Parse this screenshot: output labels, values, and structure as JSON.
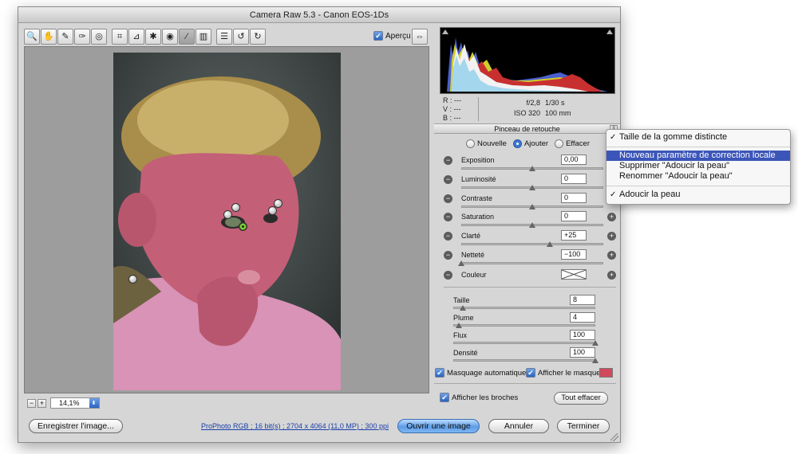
{
  "window": {
    "title": "Camera Raw 5.3  -  Canon EOS-1Ds"
  },
  "toolbar": {
    "tools": [
      {
        "name": "zoom-tool-icon",
        "glyph": "🔍"
      },
      {
        "name": "hand-tool-icon",
        "glyph": "✋"
      },
      {
        "name": "white-balance-tool-icon",
        "glyph": "✎"
      },
      {
        "name": "color-sampler-tool-icon",
        "glyph": "✑"
      },
      {
        "name": "targeted-adjustment-tool-icon",
        "glyph": "◎"
      },
      {
        "name": "crop-tool-icon",
        "glyph": "⌗"
      },
      {
        "name": "straighten-tool-icon",
        "glyph": "⊿"
      },
      {
        "name": "spot-removal-tool-icon",
        "glyph": "✱"
      },
      {
        "name": "red-eye-tool-icon",
        "glyph": "◉"
      },
      {
        "name": "adjustment-brush-icon",
        "glyph": "⁄"
      },
      {
        "name": "graduated-filter-icon",
        "glyph": "▥"
      },
      {
        "name": "preferences-icon",
        "glyph": "☰"
      },
      {
        "name": "rotate-left-icon",
        "glyph": "↺"
      },
      {
        "name": "rotate-right-icon",
        "glyph": "↻"
      }
    ],
    "preview_label": "Aperçu",
    "fullscreen_glyph": "⇔"
  },
  "zoom": {
    "value": "14,1%",
    "minus": "−",
    "plus": "+",
    "arrow": "⬍"
  },
  "readout": {
    "rgb": [
      "R :  ---",
      "V :  ---",
      "B :  ---"
    ],
    "aperture": "f/2,8",
    "shutter": "1/30 s",
    "iso": "ISO 320",
    "focal": "100 mm"
  },
  "panel": {
    "title": "Pinceau de retouche",
    "menu_glyph": "≡",
    "modes": [
      "Nouvelle",
      "Ajouter",
      "Effacer"
    ],
    "selected_mode": "Ajouter",
    "sliders": [
      {
        "label": "Exposition",
        "value": "0,00",
        "pos": 0.5
      },
      {
        "label": "Luminosité",
        "value": "0",
        "pos": 0.5
      },
      {
        "label": "Contraste",
        "value": "0",
        "pos": 0.5
      },
      {
        "label": "Saturation",
        "value": "0",
        "pos": 0.5
      },
      {
        "label": "Clarté",
        "value": "+25",
        "pos": 0.625
      },
      {
        "label": "Netteté",
        "value": "−100",
        "pos": 0.0
      }
    ],
    "color_label": "Couleur",
    "brush": [
      {
        "label": "Taille",
        "value": "8",
        "pos": 0.07
      },
      {
        "label": "Plume",
        "value": "4",
        "pos": 0.04
      },
      {
        "label": "Flux",
        "value": "100",
        "pos": 1.0
      },
      {
        "label": "Densité",
        "value": "100",
        "pos": 1.0
      }
    ],
    "auto_mask_label": "Masquage automatique",
    "show_mask_label": "Afficher le masque",
    "mask_color": "#d04a5c",
    "show_pins_label": "Afficher les broches",
    "clear_all_label": "Tout effacer"
  },
  "menu": {
    "items": [
      {
        "label": "Taille de la gomme distincte",
        "checked": true,
        "highlighted": false
      },
      {
        "sep": true
      },
      {
        "label": "Nouveau paramètre de correction locale",
        "checked": false,
        "highlighted": true
      },
      {
        "label": "Supprimer \"Adoucir la peau\"",
        "checked": false,
        "highlighted": false
      },
      {
        "label": "Renommer \"Adoucir la peau\"",
        "checked": false,
        "highlighted": false
      },
      {
        "sep": true
      },
      {
        "label": "Adoucir la peau",
        "checked": true,
        "highlighted": false
      }
    ]
  },
  "footer": {
    "save": "Enregistrer l'image...",
    "info": "ProPhoto RGB ; 16 bit(s) ; 2704 x 4064 (11,0 MP) ; 300 ppi",
    "open": "Ouvrir une image",
    "cancel": "Annuler",
    "done": "Terminer"
  },
  "icons": {
    "check": "✔",
    "checkmark": "✓"
  }
}
